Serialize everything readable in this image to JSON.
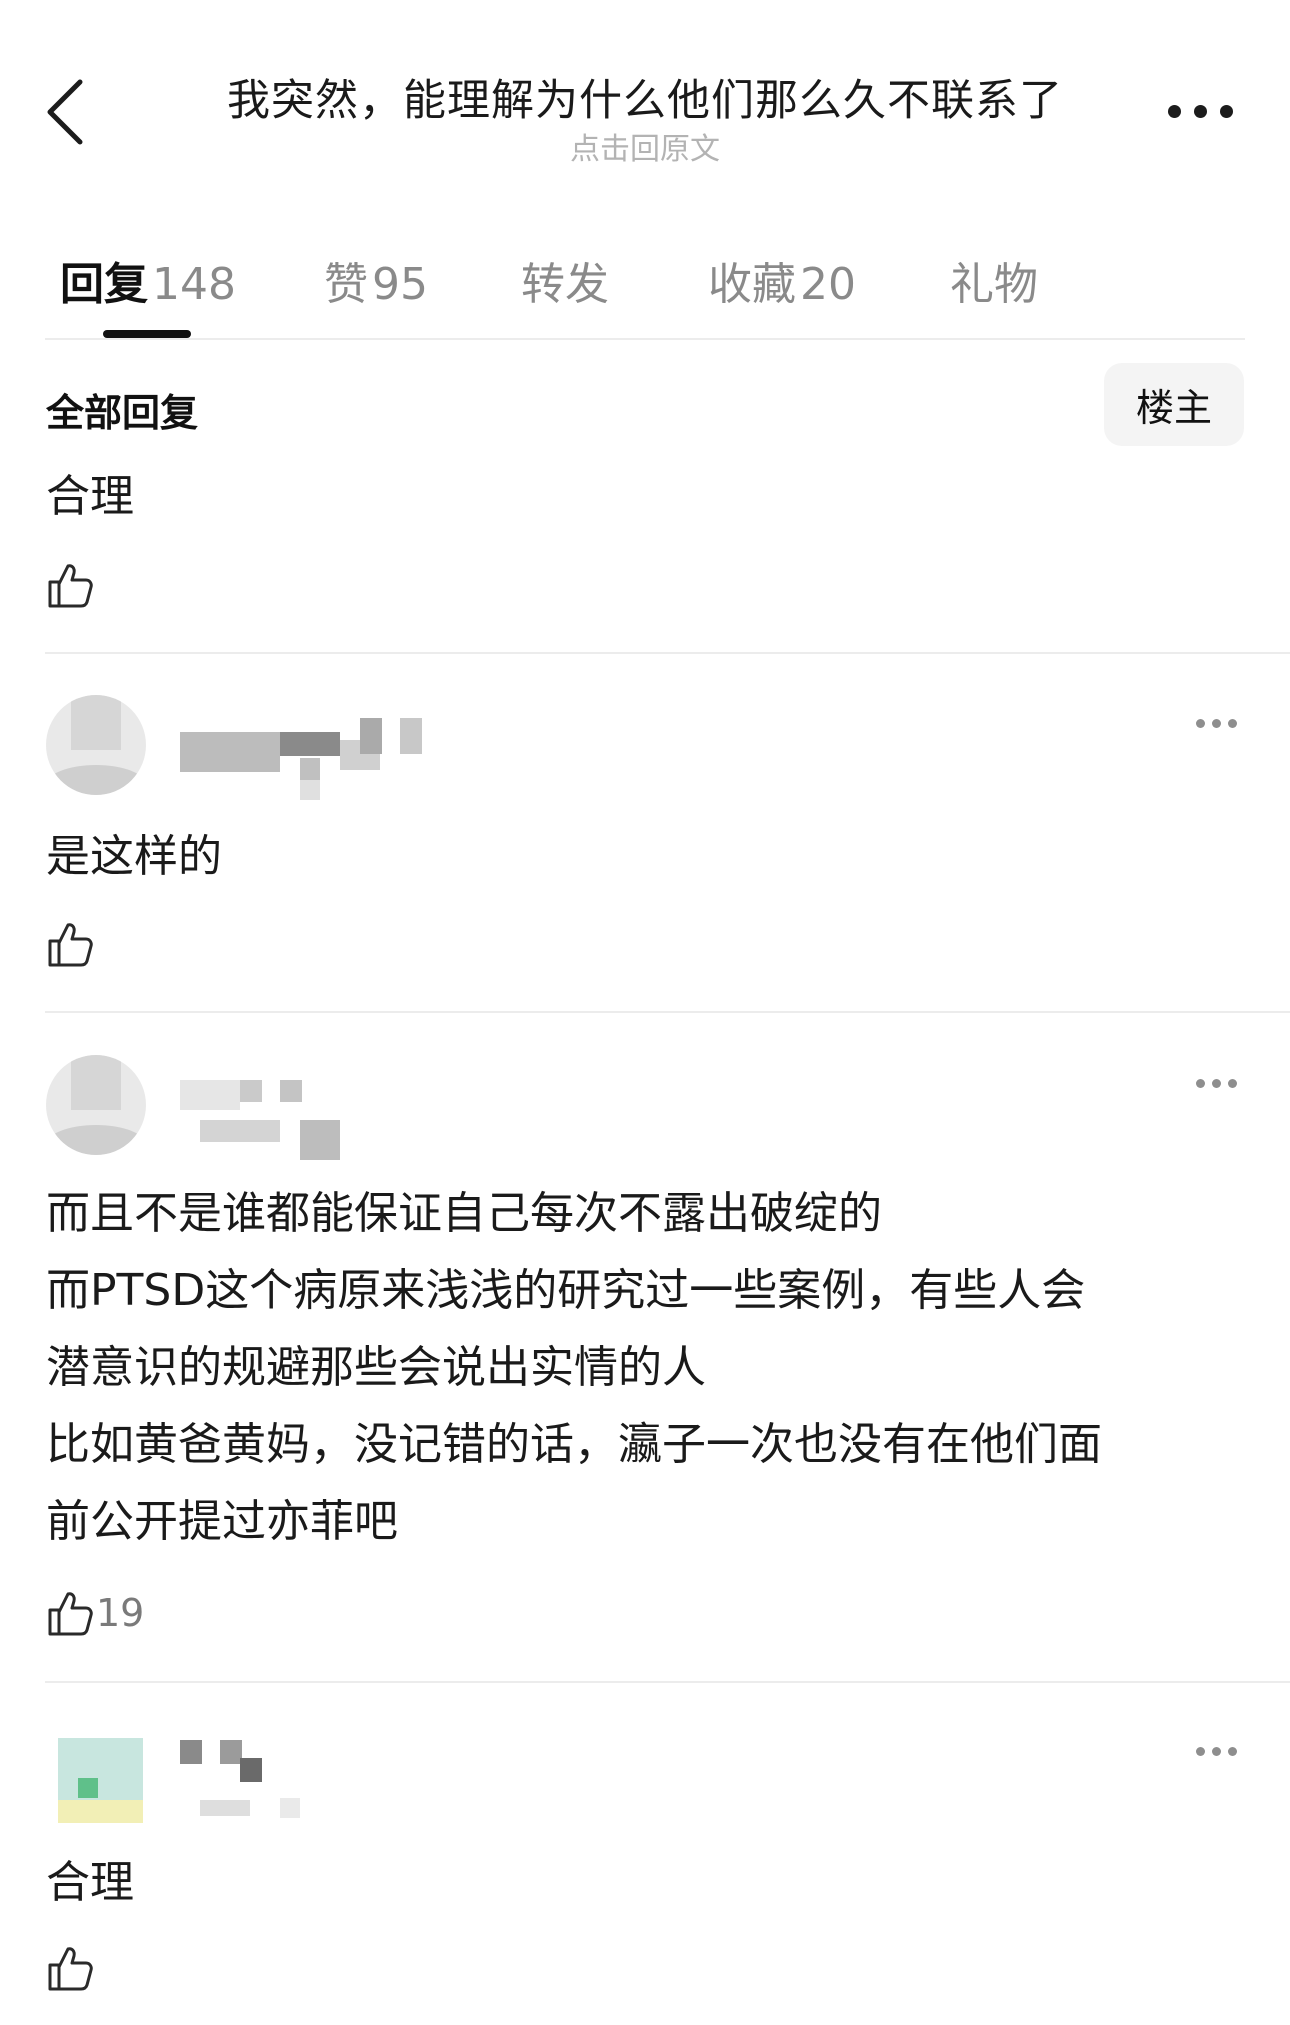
{
  "header": {
    "title": "我突然，能理解为什么他们那么久不联系了",
    "subtitle": "点击回原文"
  },
  "tabs": [
    {
      "label": "回复",
      "count": "148"
    },
    {
      "label": "赞",
      "count": "95"
    },
    {
      "label": "转发",
      "count": ""
    },
    {
      "label": "收藏",
      "count": "20"
    },
    {
      "label": "礼物",
      "count": ""
    }
  ],
  "filter": {
    "section_title": "全部回复",
    "op_button": "楼主"
  },
  "comments": [
    {
      "text_lines": [
        "合理"
      ],
      "likes": ""
    },
    {
      "text_lines": [
        "是这样的"
      ],
      "likes": ""
    },
    {
      "text_lines": [
        "而且不是谁都能保证自己每次不露出破绽的",
        "而PTSD这个病原来浅浅的研究过一些案例，有些人会",
        "潜意识的规避那些会说出实情的人",
        "比如黄爸黄妈，没记错的话，瀛子一次也没有在他们面",
        "前公开提过亦菲吧"
      ],
      "likes": "19"
    },
    {
      "text_lines": [
        "合理"
      ],
      "likes": ""
    }
  ],
  "colors": {
    "divider": "#ececec",
    "muted_text": "#8a8a8a",
    "subtitle": "#b3b3b3",
    "button_bg": "#f4f4f4"
  },
  "icons": {
    "back": "chevron-left-icon",
    "more": "more-horizontal-icon",
    "like": "thumbs-up-icon"
  }
}
